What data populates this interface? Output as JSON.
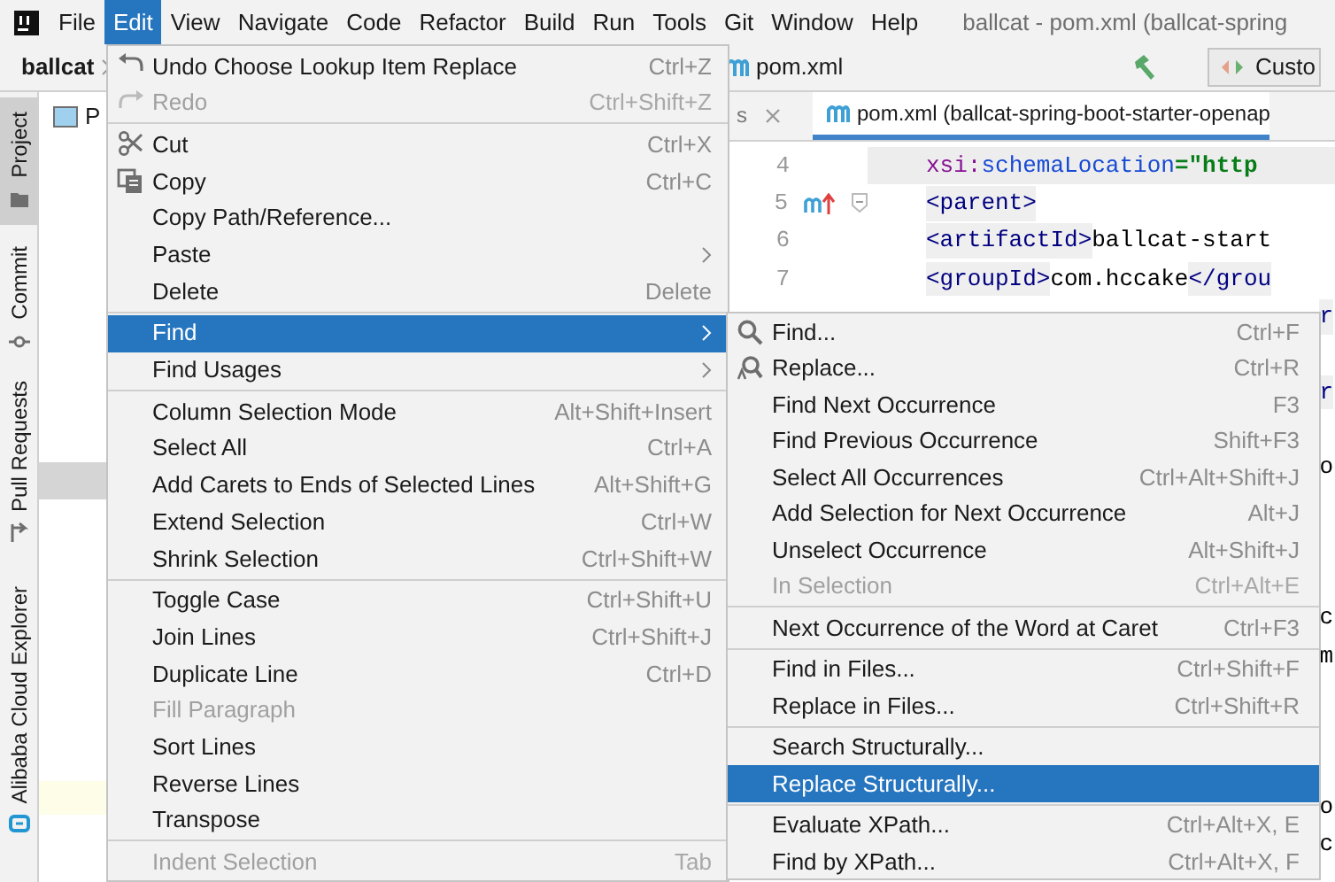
{
  "menubar": {
    "items": [
      {
        "label": "File",
        "selected": false
      },
      {
        "label": "Edit",
        "selected": true
      },
      {
        "label": "View",
        "selected": false
      },
      {
        "label": "Navigate",
        "selected": false
      },
      {
        "label": "Code",
        "selected": false
      },
      {
        "label": "Refactor",
        "selected": false
      },
      {
        "label": "Build",
        "selected": false
      },
      {
        "label": "Run",
        "selected": false
      },
      {
        "label": "Tools",
        "selected": false
      },
      {
        "label": "Git",
        "selected": false
      },
      {
        "label": "Window",
        "selected": false
      },
      {
        "label": "Help",
        "selected": false
      }
    ],
    "window_title": "ballcat - pom.xml (ballcat-spring"
  },
  "toolbar": {
    "breadcrumb": "ballcat",
    "file": "pom.xml",
    "run_config": "Custo"
  },
  "tool_stripe": [
    {
      "label": "Project",
      "selected": true,
      "kind": "folder"
    },
    {
      "label": "Commit",
      "selected": false,
      "kind": "commit"
    },
    {
      "label": "Pull Requests",
      "selected": false,
      "kind": "pull"
    },
    {
      "label": "Alibaba Cloud Explorer",
      "selected": false,
      "kind": "cloud"
    }
  ],
  "project_panel": {
    "title": "P"
  },
  "editor": {
    "tabs": [
      {
        "label": "s",
        "selected": false
      },
      {
        "label": "pom.xml (ballcat-spring-boot-starter-openap",
        "selected": true
      }
    ],
    "lines": [
      {
        "number": "4",
        "current": true,
        "gutter_mark": false,
        "foldable": false,
        "tokens": [
          {
            "kind": "ns",
            "text": "     xsi:"
          },
          {
            "kind": "attr",
            "text": "schemaLocation"
          },
          {
            "kind": "string",
            "text": "=\"http"
          }
        ]
      },
      {
        "number": "5",
        "current": false,
        "gutter_mark": true,
        "foldable": true,
        "tokens": [
          {
            "kind": "tag",
            "text": "<parent>"
          }
        ]
      },
      {
        "number": "6",
        "current": false,
        "gutter_mark": false,
        "foldable": false,
        "tokens": [
          {
            "kind": "tag",
            "text": "    <artifactId>"
          },
          {
            "kind": "text",
            "text": "ballcat-start"
          }
        ]
      },
      {
        "number": "7",
        "current": false,
        "gutter_mark": false,
        "foldable": false,
        "tokens": [
          {
            "kind": "tag",
            "text": "    <groupId>"
          },
          {
            "kind": "text",
            "text": "com.hccake"
          },
          {
            "kind": "tag",
            "text": "</grou"
          }
        ]
      }
    ],
    "line_tails": [
      {
        "kind": "tag",
        "text": "r"
      },
      {
        "kind": "tag",
        "text": "r"
      },
      {
        "kind": "text",
        "text": "o"
      },
      {
        "kind": "text",
        "text": "c"
      },
      {
        "kind": "text",
        "text": "m"
      },
      {
        "kind": "text",
        "text": "o"
      },
      {
        "kind": "text",
        "text": "c"
      }
    ]
  },
  "edit_menu": {
    "items": [
      {
        "kind": "undo",
        "label": "Undo Choose Lookup Item Replace",
        "shortcut": "Ctrl+Z",
        "disabled": false,
        "selected": false,
        "has_submenu": false
      },
      {
        "kind": "redo",
        "label": "Redo",
        "shortcut": "Ctrl+Shift+Z",
        "disabled": true,
        "selected": false,
        "has_submenu": false
      },
      {
        "kind": "separator"
      },
      {
        "kind": "cut",
        "label": "Cut",
        "shortcut": "Ctrl+X",
        "disabled": false,
        "selected": false,
        "has_submenu": false
      },
      {
        "kind": "copy",
        "label": "Copy",
        "shortcut": "Ctrl+C",
        "disabled": false,
        "selected": false,
        "has_submenu": false
      },
      {
        "kind": "item",
        "label": "Copy Path/Reference...",
        "disabled": false,
        "selected": false,
        "has_submenu": false
      },
      {
        "kind": "item",
        "label": "Paste",
        "disabled": false,
        "selected": false,
        "has_submenu": true
      },
      {
        "kind": "item",
        "label": "Delete",
        "shortcut": "Delete",
        "disabled": false,
        "selected": false,
        "has_submenu": false
      },
      {
        "kind": "separator"
      },
      {
        "kind": "item",
        "label": "Find",
        "disabled": false,
        "selected": true,
        "has_submenu": true
      },
      {
        "kind": "item",
        "label": "Find Usages",
        "disabled": false,
        "selected": false,
        "has_submenu": true
      },
      {
        "kind": "separator"
      },
      {
        "kind": "item",
        "label": "Column Selection Mode",
        "shortcut": "Alt+Shift+Insert",
        "disabled": false,
        "selected": false,
        "has_submenu": false
      },
      {
        "kind": "item",
        "label": "Select All",
        "shortcut": "Ctrl+A",
        "disabled": false,
        "selected": false,
        "has_submenu": false
      },
      {
        "kind": "item",
        "label": "Add Carets to Ends of Selected Lines",
        "shortcut": "Alt+Shift+G",
        "disabled": false,
        "selected": false,
        "has_submenu": false
      },
      {
        "kind": "item",
        "label": "Extend Selection",
        "shortcut": "Ctrl+W",
        "disabled": false,
        "selected": false,
        "has_submenu": false
      },
      {
        "kind": "item",
        "label": "Shrink Selection",
        "shortcut": "Ctrl+Shift+W",
        "disabled": false,
        "selected": false,
        "has_submenu": false
      },
      {
        "kind": "separator"
      },
      {
        "kind": "item",
        "label": "Toggle Case",
        "shortcut": "Ctrl+Shift+U",
        "disabled": false,
        "selected": false,
        "has_submenu": false
      },
      {
        "kind": "item",
        "label": "Join Lines",
        "shortcut": "Ctrl+Shift+J",
        "disabled": false,
        "selected": false,
        "has_submenu": false
      },
      {
        "kind": "item",
        "label": "Duplicate Line",
        "shortcut": "Ctrl+D",
        "disabled": false,
        "selected": false,
        "has_submenu": false
      },
      {
        "kind": "item",
        "label": "Fill Paragraph",
        "disabled": true,
        "selected": false,
        "has_submenu": false
      },
      {
        "kind": "item",
        "label": "Sort Lines",
        "disabled": false,
        "selected": false,
        "has_submenu": false
      },
      {
        "kind": "item",
        "label": "Reverse Lines",
        "disabled": false,
        "selected": false,
        "has_submenu": false
      },
      {
        "kind": "item",
        "label": "Transpose",
        "disabled": false,
        "selected": false,
        "has_submenu": false
      },
      {
        "kind": "separator"
      },
      {
        "kind": "item",
        "label": "Indent Selection",
        "shortcut": "Tab",
        "disabled": true,
        "selected": false,
        "has_submenu": false
      }
    ]
  },
  "find_submenu": {
    "items": [
      {
        "kind": "find",
        "label": "Find...",
        "shortcut": "Ctrl+F",
        "disabled": false,
        "selected": false
      },
      {
        "kind": "replace",
        "label": "Replace...",
        "shortcut": "Ctrl+R",
        "disabled": false,
        "selected": false
      },
      {
        "kind": "item",
        "label": "Find Next Occurrence",
        "shortcut": "F3",
        "disabled": false,
        "selected": false
      },
      {
        "kind": "item",
        "label": "Find Previous Occurrence",
        "shortcut": "Shift+F3",
        "disabled": false,
        "selected": false
      },
      {
        "kind": "item",
        "label": "Select All Occurrences",
        "shortcut": "Ctrl+Alt+Shift+J",
        "disabled": false,
        "selected": false
      },
      {
        "kind": "item",
        "label": "Add Selection for Next Occurrence",
        "shortcut": "Alt+J",
        "disabled": false,
        "selected": false
      },
      {
        "kind": "item",
        "label": "Unselect Occurrence",
        "shortcut": "Alt+Shift+J",
        "disabled": false,
        "selected": false
      },
      {
        "kind": "item",
        "label": "In Selection",
        "shortcut": "Ctrl+Alt+E",
        "disabled": true,
        "selected": false
      },
      {
        "kind": "separator"
      },
      {
        "kind": "item",
        "label": "Next Occurrence of the Word at Caret",
        "shortcut": "Ctrl+F3",
        "disabled": false,
        "selected": false
      },
      {
        "kind": "separator"
      },
      {
        "kind": "item",
        "label": "Find in Files...",
        "shortcut": "Ctrl+Shift+F",
        "disabled": false,
        "selected": false
      },
      {
        "kind": "item",
        "label": "Replace in Files...",
        "shortcut": "Ctrl+Shift+R",
        "disabled": false,
        "selected": false
      },
      {
        "kind": "separator"
      },
      {
        "kind": "item",
        "label": "Search Structurally...",
        "disabled": false,
        "selected": false
      },
      {
        "kind": "item",
        "label": "Replace Structurally...",
        "disabled": false,
        "selected": true
      },
      {
        "kind": "separator"
      },
      {
        "kind": "item",
        "label": "Evaluate XPath...",
        "shortcut": "Ctrl+Alt+X, E",
        "disabled": false,
        "selected": false
      },
      {
        "kind": "item",
        "label": "Find by XPath...",
        "shortcut": "Ctrl+Alt+X, F",
        "disabled": false,
        "selected": false
      }
    ]
  }
}
